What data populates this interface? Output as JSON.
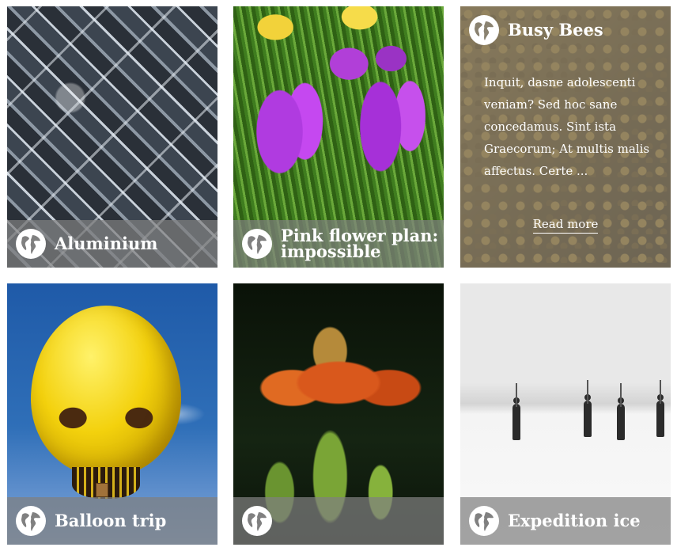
{
  "tiles": [
    {
      "title": "Aluminium",
      "icon": "globe-icon"
    },
    {
      "title": "Pink flower plan: impossible",
      "icon": "globe-icon"
    },
    {
      "title": "Busy Bees",
      "icon": "globe-icon",
      "excerpt": "Inquit, dasne adolescenti veniam? Sed hoc sane concedamus. Sint ista Graecorum; At multis malis affectus. Certe ...",
      "read_more": "Read more"
    },
    {
      "title": "Balloon trip",
      "icon": "globe-icon"
    },
    {
      "title": "",
      "icon": "globe-icon"
    },
    {
      "title": "Expedition ice",
      "icon": "globe-icon"
    }
  ],
  "colors": {
    "caption_bg": "#808080",
    "caption_text": "#ffffff"
  }
}
